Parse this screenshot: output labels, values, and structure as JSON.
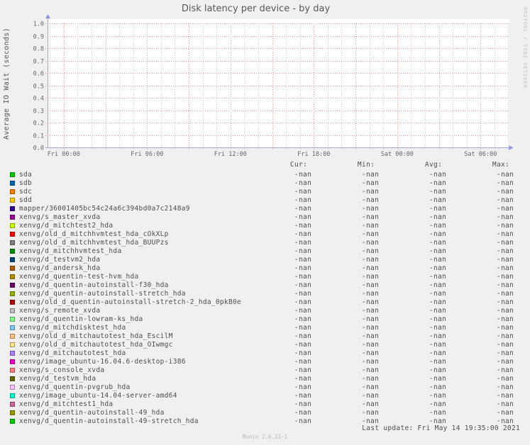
{
  "title": "Disk latency per device - by day",
  "watermark": "RRDTOOL / TOBI OETIKER",
  "footer": {
    "last_update": "Last update: Fri May 14 19:35:00 2021",
    "version": "Munin 2.0.33-1"
  },
  "legend_columns": [
    "Cur:",
    "Min:",
    "Avg:",
    "Max:"
  ],
  "chart_data": {
    "type": "line",
    "title": "Disk latency per device - by day",
    "xlabel": "",
    "ylabel": "Average IO Wait (seconds)",
    "ylim": [
      0.0,
      1.0
    ],
    "y_tick_step": 0.1,
    "y_ticks": [
      "1.0",
      "0.9",
      "0.8",
      "0.7",
      "0.6",
      "0.5",
      "0.4",
      "0.3",
      "0.2",
      "0.1",
      "0.0"
    ],
    "x_ticks": [
      "Fri 00:00",
      "Fri 06:00",
      "Fri 12:00",
      "Fri 18:00",
      "Sat 00:00",
      "Sat 06:00"
    ],
    "grid": true,
    "note": "No data lines plotted; every series value is -nan (empty graph).",
    "colors": {
      "background": "#f0f0f0",
      "canvas": "#ffffff",
      "major_grid": "#ee9999",
      "minor_grid": "#cfcfcf",
      "axis": "#a3a7cc",
      "arrow": "#8f96e0"
    },
    "series": [
      {
        "name": "sda",
        "color": "#00CC00",
        "cur": "-nan",
        "min": "-nan",
        "avg": "-nan",
        "max": "-nan"
      },
      {
        "name": "sdb",
        "color": "#0066B3",
        "cur": "-nan",
        "min": "-nan",
        "avg": "-nan",
        "max": "-nan"
      },
      {
        "name": "sdc",
        "color": "#FF8000",
        "cur": "-nan",
        "min": "-nan",
        "avg": "-nan",
        "max": "-nan"
      },
      {
        "name": "sdd",
        "color": "#FFCC00",
        "cur": "-nan",
        "min": "-nan",
        "avg": "-nan",
        "max": "-nan"
      },
      {
        "name": "mapper/36001405bc54c24a6c394bd0a7c2148a9",
        "color": "#330099",
        "cur": "-nan",
        "min": "-nan",
        "avg": "-nan",
        "max": "-nan"
      },
      {
        "name": "xenvg/s_master_xvda",
        "color": "#990099",
        "cur": "-nan",
        "min": "-nan",
        "avg": "-nan",
        "max": "-nan"
      },
      {
        "name": "xenvg/d_mitchtest2_hda",
        "color": "#CCFF00",
        "cur": "-nan",
        "min": "-nan",
        "avg": "-nan",
        "max": "-nan"
      },
      {
        "name": "xenvg/old_d_mitchhvmtest_hda_cOkXLp",
        "color": "#FF0000",
        "cur": "-nan",
        "min": "-nan",
        "avg": "-nan",
        "max": "-nan"
      },
      {
        "name": "xenvg/old_d_mitchhvmtest_hda_BUUPzs",
        "color": "#808080",
        "cur": "-nan",
        "min": "-nan",
        "avg": "-nan",
        "max": "-nan"
      },
      {
        "name": "xenvg/d_mitchhvmtest_hda",
        "color": "#008F00",
        "cur": "-nan",
        "min": "-nan",
        "avg": "-nan",
        "max": "-nan"
      },
      {
        "name": "xenvg/d_testvm2_hda",
        "color": "#00487D",
        "cur": "-nan",
        "min": "-nan",
        "avg": "-nan",
        "max": "-nan"
      },
      {
        "name": "xenvg/d_andersk_hda",
        "color": "#B35A00",
        "cur": "-nan",
        "min": "-nan",
        "avg": "-nan",
        "max": "-nan"
      },
      {
        "name": "xenvg/d_quentin-test-hvm_hda",
        "color": "#B38F00",
        "cur": "-nan",
        "min": "-nan",
        "avg": "-nan",
        "max": "-nan"
      },
      {
        "name": "xenvg/d_quentin-autoinstall-f30_hda",
        "color": "#6B006B",
        "cur": "-nan",
        "min": "-nan",
        "avg": "-nan",
        "max": "-nan"
      },
      {
        "name": "xenvg/d_quentin-autoinstall-stretch_hda",
        "color": "#8FB300",
        "cur": "-nan",
        "min": "-nan",
        "avg": "-nan",
        "max": "-nan"
      },
      {
        "name": "xenvg/old_d_quentin-autoinstall-stretch-2_hda_0pkB0e",
        "color": "#B30000",
        "cur": "-nan",
        "min": "-nan",
        "avg": "-nan",
        "max": "-nan"
      },
      {
        "name": "xenvg/s_remote_xvda",
        "color": "#BEBEBE",
        "cur": "-nan",
        "min": "-nan",
        "avg": "-nan",
        "max": "-nan"
      },
      {
        "name": "xenvg/d_quentin-lowram-ks_hda",
        "color": "#80FF80",
        "cur": "-nan",
        "min": "-nan",
        "avg": "-nan",
        "max": "-nan"
      },
      {
        "name": "xenvg/d_mitchdisktest_hda",
        "color": "#80C9FF",
        "cur": "-nan",
        "min": "-nan",
        "avg": "-nan",
        "max": "-nan"
      },
      {
        "name": "xenvg/old_d_mitchautotest_hda_EscilM",
        "color": "#FFC080",
        "cur": "-nan",
        "min": "-nan",
        "avg": "-nan",
        "max": "-nan"
      },
      {
        "name": "xenvg/old_d_mitchautotest_hda_OIwmgc",
        "color": "#FFE680",
        "cur": "-nan",
        "min": "-nan",
        "avg": "-nan",
        "max": "-nan"
      },
      {
        "name": "xenvg/d_mitchautotest_hda",
        "color": "#AA80FF",
        "cur": "-nan",
        "min": "-nan",
        "avg": "-nan",
        "max": "-nan"
      },
      {
        "name": "xenvg/image_ubuntu-16.04.6-desktop-i386",
        "color": "#EE00CC",
        "cur": "-nan",
        "min": "-nan",
        "avg": "-nan",
        "max": "-nan"
      },
      {
        "name": "xenvg/s_console_xvda",
        "color": "#FF8080",
        "cur": "-nan",
        "min": "-nan",
        "avg": "-nan",
        "max": "-nan"
      },
      {
        "name": "xenvg/d_testvm_hda",
        "color": "#666600",
        "cur": "-nan",
        "min": "-nan",
        "avg": "-nan",
        "max": "-nan"
      },
      {
        "name": "xenvg/d_quentin-pvgrub_hda",
        "color": "#FFBFFF",
        "cur": "-nan",
        "min": "-nan",
        "avg": "-nan",
        "max": "-nan"
      },
      {
        "name": "xenvg/image_ubuntu-14.04-server-amd64",
        "color": "#00FFCC",
        "cur": "-nan",
        "min": "-nan",
        "avg": "-nan",
        "max": "-nan"
      },
      {
        "name": "xenvg/d_mitchtest1_hda",
        "color": "#CC6699",
        "cur": "-nan",
        "min": "-nan",
        "avg": "-nan",
        "max": "-nan"
      },
      {
        "name": "xenvg/d_quentin-autoinstall-49_hda",
        "color": "#999900",
        "cur": "-nan",
        "min": "-nan",
        "avg": "-nan",
        "max": "-nan"
      },
      {
        "name": "xenvg/d_quentin-autoinstall-49-stretch_hda",
        "color": "#00CC00",
        "cur": "-nan",
        "min": "-nan",
        "avg": "-nan",
        "max": "-nan"
      }
    ]
  }
}
